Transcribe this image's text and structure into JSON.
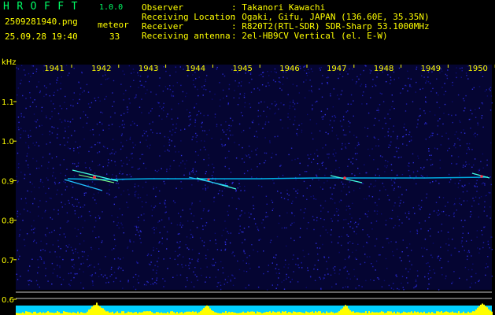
{
  "header": {
    "app_title": "HROFFT",
    "app_version": "1.0.0",
    "file_name": "2509281940.png",
    "datetime": "25.09.28 19:40",
    "meteor_label": "meteor",
    "meteor_count": "33"
  },
  "info": [
    {
      "key": "Observer",
      "value": ": Takanori Kawachi"
    },
    {
      "key": "Receiving Location",
      "value": ": Ogaki, Gifu, JAPAN (136.60E, 35.35N)"
    },
    {
      "key": "Receiver",
      "value": ": R820T2(RTL-SDR) SDR-Sharp 53.1000MHz"
    },
    {
      "key": "Receiving antenna",
      "value": ": 2el-HB9CV Vertical (el. E-W)"
    }
  ],
  "axis": {
    "unit": "kHz",
    "time_ticks": [
      "1941",
      "1942",
      "1943",
      "1944",
      "1945",
      "1946",
      "1947",
      "1948",
      "1949",
      "1950"
    ],
    "freq_ticks": [
      "1.1",
      "1.0",
      "0.9",
      "0.8",
      "0.7",
      "0.6"
    ],
    "freq_values": [
      1.1,
      1.0,
      0.9,
      0.8,
      0.7,
      0.6
    ],
    "freq_min": 0.6,
    "freq_max": 1.1
  },
  "colors": {
    "background": "#000000",
    "noise": "#1a1aa0",
    "trace": "#00e0ff",
    "highlight": "#ff3040",
    "axis_text": "#ffff00",
    "header_green": "#00ff66",
    "level_bar": "#ffff00",
    "level_base": "#00d0ff"
  }
}
